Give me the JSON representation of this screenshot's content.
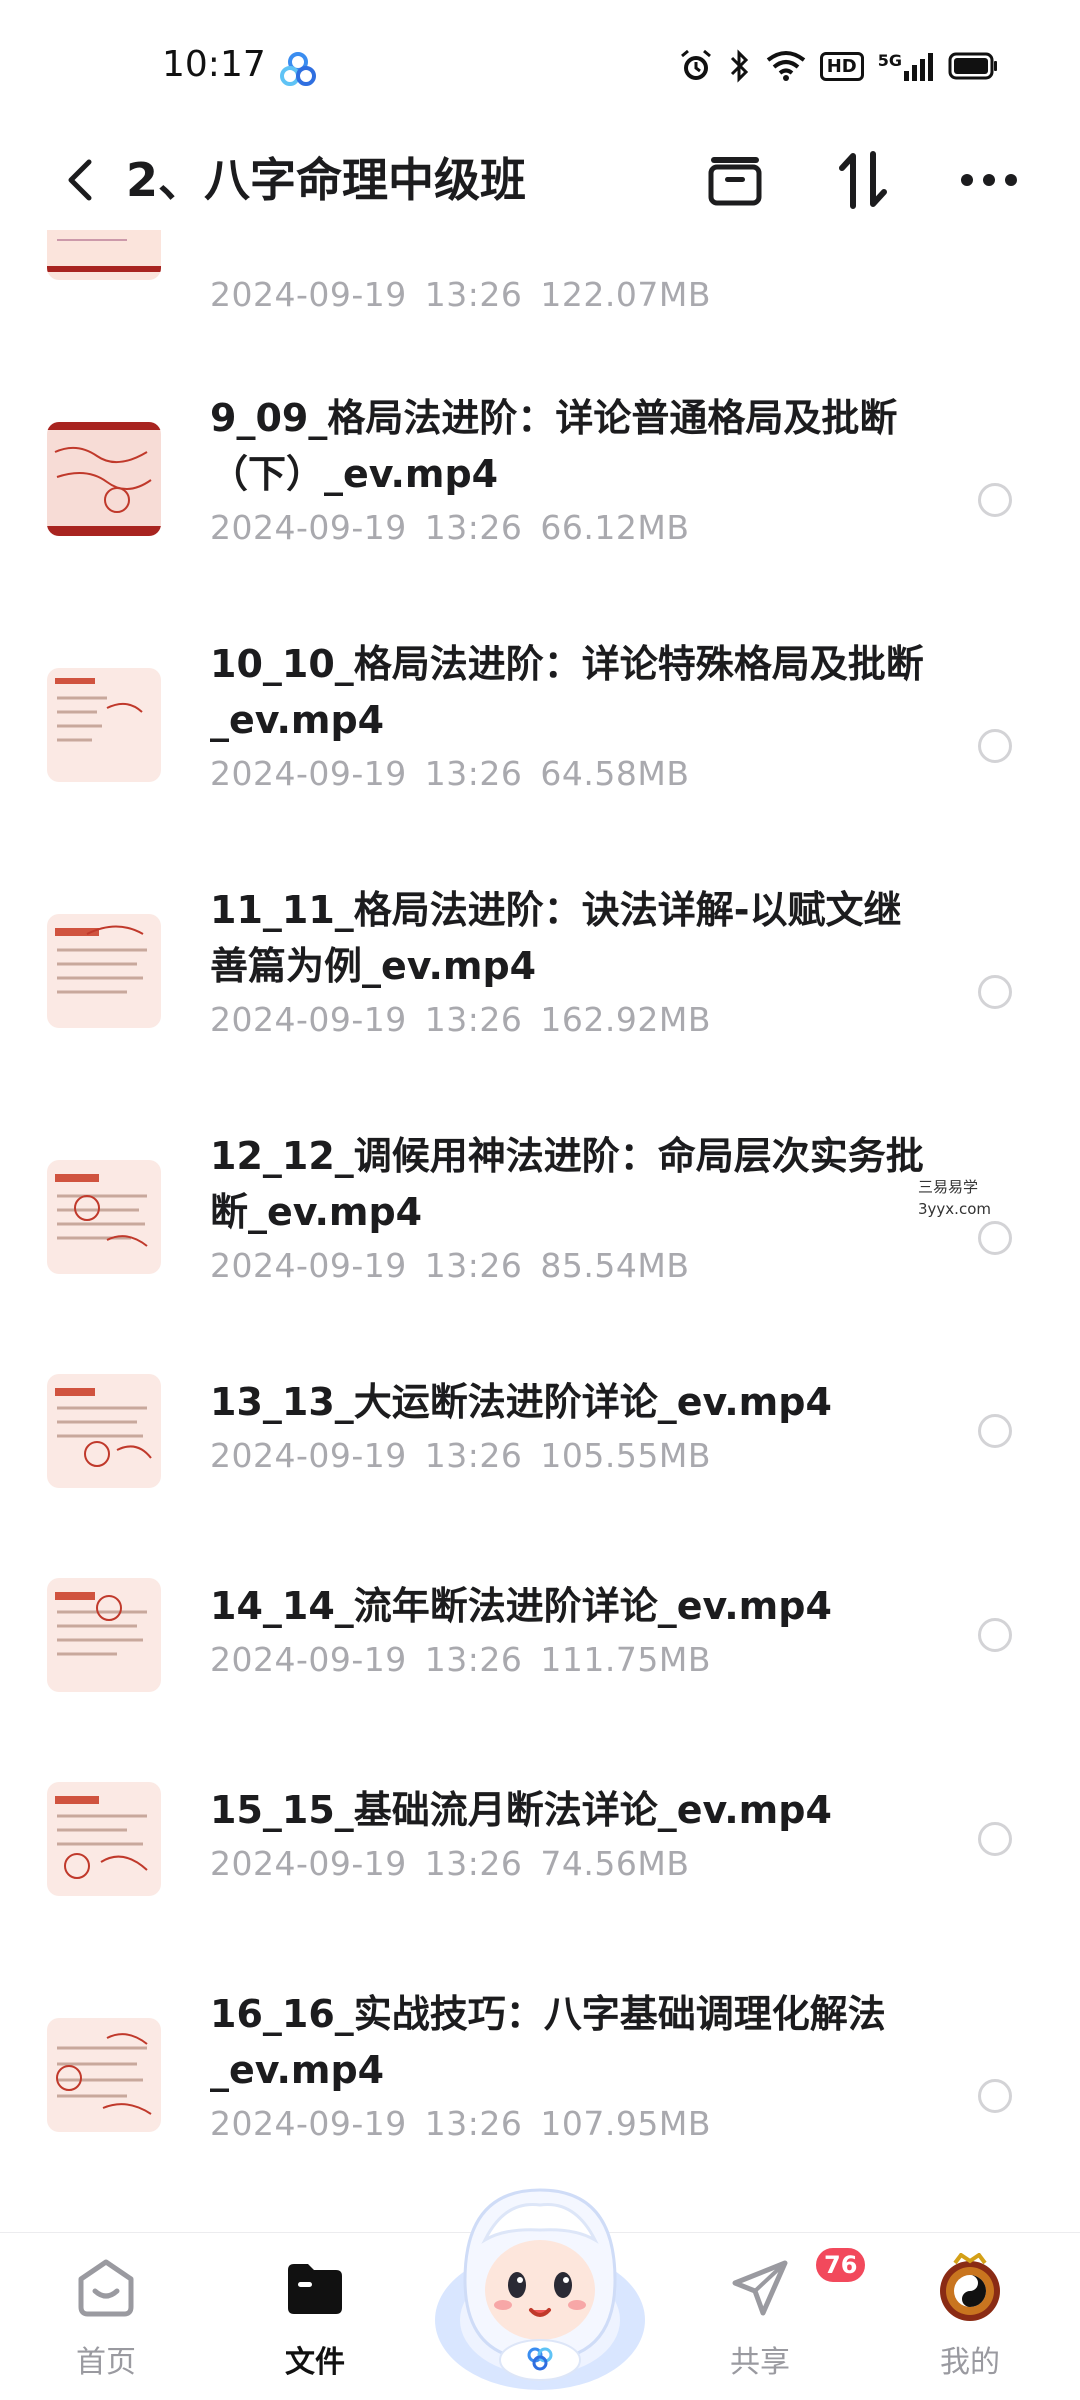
{
  "status_bar": {
    "time": "10:17",
    "icons": [
      "alarm-icon",
      "bluetooth-icon",
      "wifi-icon",
      "hd-icon",
      "signal-5g-icon",
      "battery-icon"
    ],
    "hd_label": "HD",
    "network_label": "5G"
  },
  "header": {
    "title": "2、八字命理中级班",
    "actions": [
      "archive-icon",
      "sort-icon",
      "more-icon"
    ]
  },
  "files": [
    {
      "name": "",
      "date": "2024-09-19",
      "time": "13:26",
      "size": "122.07MB"
    },
    {
      "name": "9_09_格局法进阶：详论普通格局及批断（下）_ev.mp4",
      "date": "2024-09-19",
      "time": "13:26",
      "size": "66.12MB"
    },
    {
      "name": "10_10_格局法进阶：详论特殊格局及批断_ev.mp4",
      "date": "2024-09-19",
      "time": "13:26",
      "size": "64.58MB"
    },
    {
      "name": "11_11_格局法进阶：诀法详解-以赋文继善篇为例_ev.mp4",
      "date": "2024-09-19",
      "time": "13:26",
      "size": "162.92MB"
    },
    {
      "name": "12_12_调候用神法进阶：命局层次实务批断_ev.mp4",
      "date": "2024-09-19",
      "time": "13:26",
      "size": "85.54MB"
    },
    {
      "name": "13_13_大运断法进阶详论_ev.mp4",
      "date": "2024-09-19",
      "time": "13:26",
      "size": "105.55MB"
    },
    {
      "name": "14_14_流年断法进阶详论_ev.mp4",
      "date": "2024-09-19",
      "time": "13:26",
      "size": "111.75MB"
    },
    {
      "name": "15_15_基础流月断法详论_ev.mp4",
      "date": "2024-09-19",
      "time": "13:26",
      "size": "74.56MB"
    },
    {
      "name": "16_16_实战技巧：八字基础调理化解法_ev.mp4",
      "date": "2024-09-19",
      "time": "13:26",
      "size": "107.95MB"
    }
  ],
  "watermark": {
    "line1": "三易易学",
    "line2": "3yyx.com"
  },
  "bottom_nav": {
    "home": "首页",
    "files": "文件",
    "share": "共享",
    "share_badge": "76",
    "mine": "我的"
  },
  "colors": {
    "accent_badge": "#f2495c",
    "meta_text": "#a9a9ae",
    "thumb_bg": "#fbe9e4"
  }
}
